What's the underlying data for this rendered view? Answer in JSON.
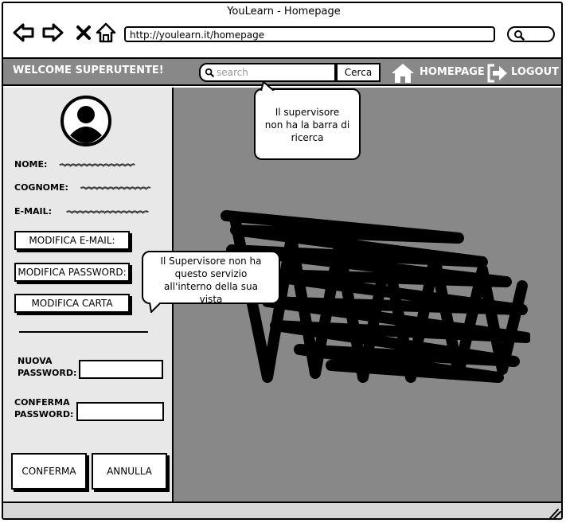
{
  "window": {
    "title": "YouLearn - Homepage"
  },
  "browser": {
    "url": "http://youlearn.it/homepage",
    "icons": [
      "back-arrow-icon",
      "forward-arrow-icon",
      "close-icon",
      "home-icon",
      "search-icon"
    ]
  },
  "header": {
    "welcome": "WELCOME SUPERUTENTE!",
    "search_placeholder": "search",
    "search_button": "Cerca",
    "homepage_label": "HOMEPAGE",
    "logout_label": "LOGOUT"
  },
  "profile": {
    "nome_label": "NOME:",
    "cognome_label": "COGNOME:",
    "email_label": "E-MAIL:"
  },
  "sidebar_buttons": {
    "edit_email": "MODIFICA E-MAIL:",
    "edit_password": "MODIFICA PASSWORD:",
    "edit_card": "MODIFICA CARTA"
  },
  "password_form": {
    "new_password_line1": "NUOVA",
    "new_password_line2": "PASSWORD:",
    "confirm_password_line1": "CONFERMA",
    "confirm_password_line2": "PASSWORD:",
    "confirm_button": "CONFERMA",
    "cancel_button": "ANNULLA"
  },
  "callouts": {
    "search_note_l1": "Il supervisore",
    "search_note_l2": "non ha la barra di",
    "search_note_l3": "ricerca",
    "service_note_l1": "Il Supervisore non ha",
    "service_note_l2": "questo servizio",
    "service_note_l3": "all'interno della sua",
    "service_note_l4": "vista"
  },
  "colors": {
    "bar_gray": "#888888",
    "sidebar_bg": "#e8e8e8",
    "white": "#ffffff",
    "black": "#000000"
  }
}
